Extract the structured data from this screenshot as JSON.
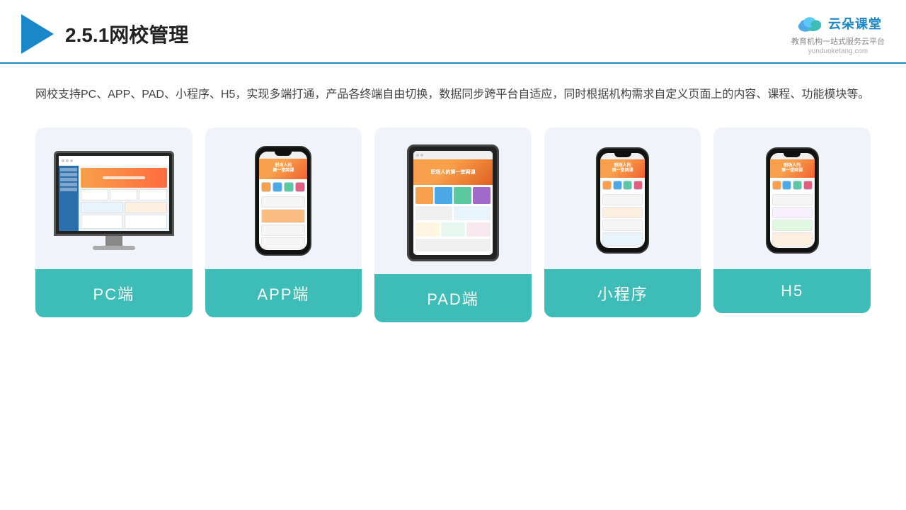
{
  "header": {
    "title": "2.5.1网校管理",
    "logo_main": "云朵课堂",
    "logo_url": "yunduoketang.com",
    "logo_sub": "教育机构一站\n式服务云平台"
  },
  "description": "网校支持PC、APP、PAD、小程序、H5，实现多端打通，产品各终端自由切换，数据同步跨平台自适应，同时根据机构需求自定义页面上的内容、课程、功能模块等。",
  "cards": [
    {
      "id": "pc",
      "label": "PC端"
    },
    {
      "id": "app",
      "label": "APP端"
    },
    {
      "id": "pad",
      "label": "PAD端"
    },
    {
      "id": "miniapp",
      "label": "小程序"
    },
    {
      "id": "h5",
      "label": "H5"
    }
  ],
  "accent_color": "#3dbcb8",
  "title_color": "#222",
  "play_icon_color": "#1a87c8"
}
